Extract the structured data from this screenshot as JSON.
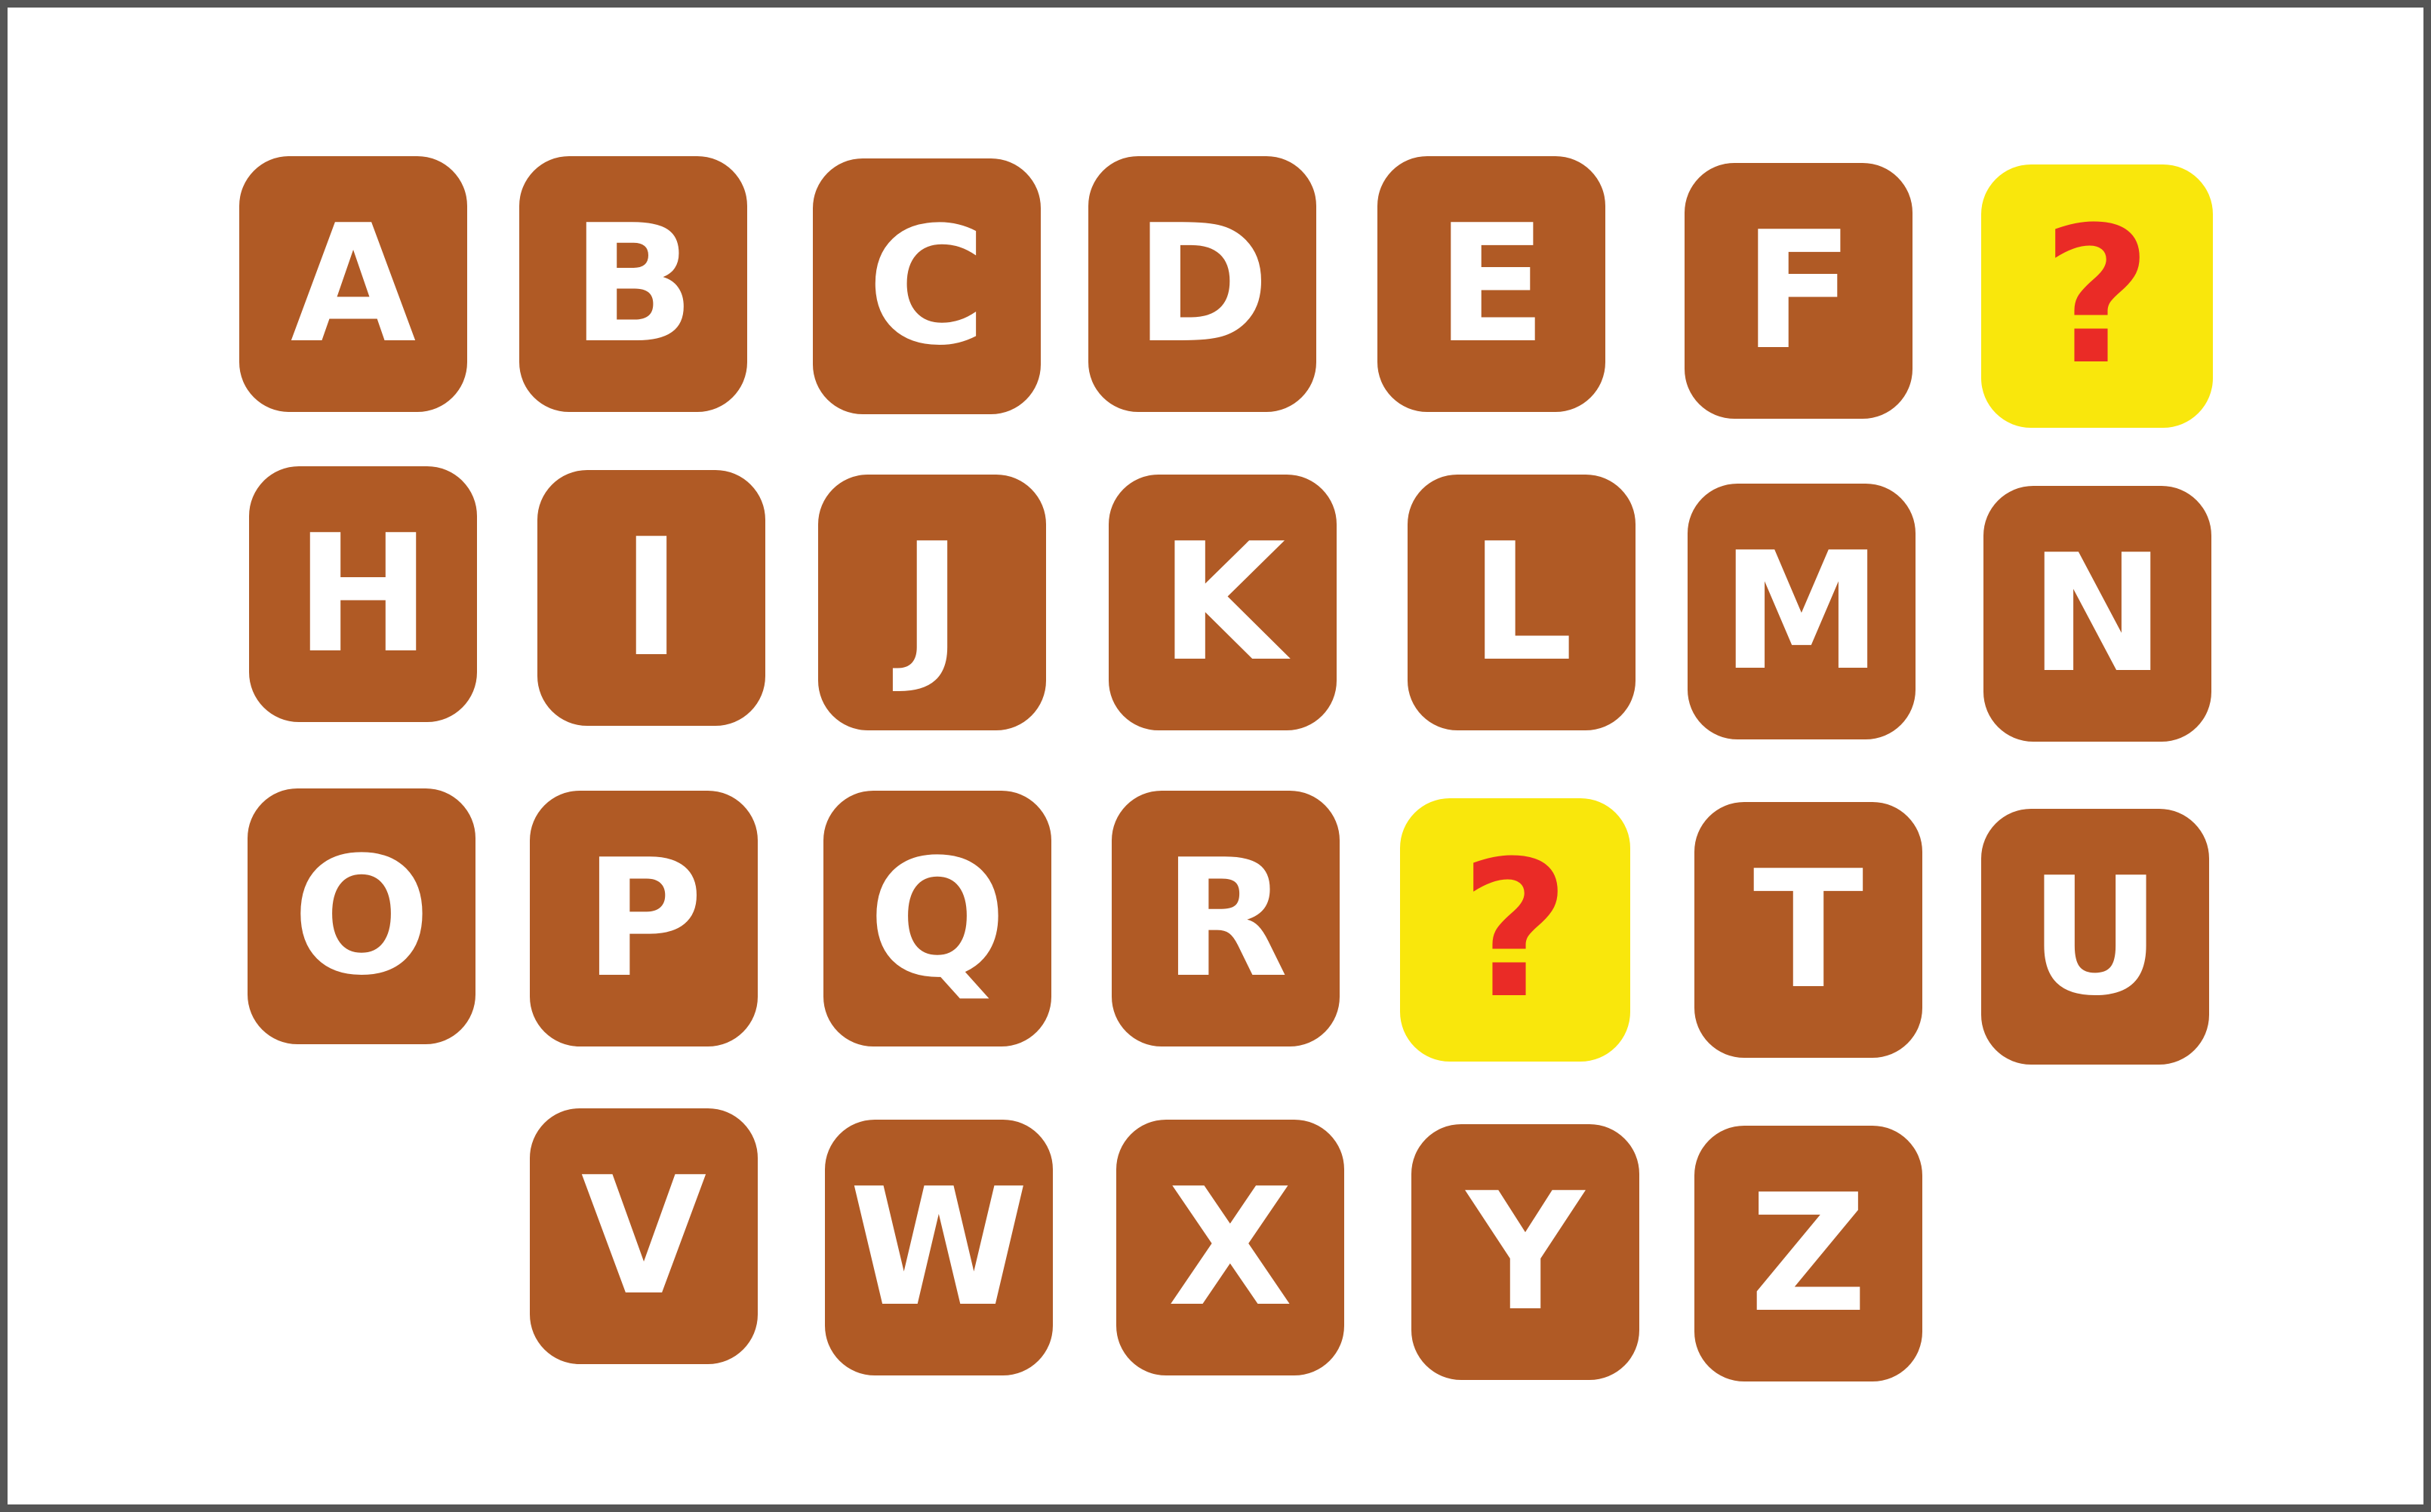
{
  "colors": {
    "tile": "#b05a25",
    "letter": "#ffffff",
    "missing_tile": "#f9e70c",
    "missing_mark": "#ea2b26",
    "frame": "#555555",
    "background": "#ffffff"
  },
  "tiles": [
    {
      "label": "A",
      "missing": false
    },
    {
      "label": "B",
      "missing": false
    },
    {
      "label": "C",
      "missing": false
    },
    {
      "label": "D",
      "missing": false
    },
    {
      "label": "E",
      "missing": false
    },
    {
      "label": "F",
      "missing": false
    },
    {
      "label": "?",
      "missing": true
    },
    {
      "label": "H",
      "missing": false
    },
    {
      "label": "I",
      "missing": false
    },
    {
      "label": "J",
      "missing": false
    },
    {
      "label": "K",
      "missing": false
    },
    {
      "label": "L",
      "missing": false
    },
    {
      "label": "M",
      "missing": false
    },
    {
      "label": "N",
      "missing": false
    },
    {
      "label": "O",
      "missing": false
    },
    {
      "label": "P",
      "missing": false
    },
    {
      "label": "Q",
      "missing": false
    },
    {
      "label": "R",
      "missing": false
    },
    {
      "label": "?",
      "missing": true
    },
    {
      "label": "T",
      "missing": false
    },
    {
      "label": "U",
      "missing": false
    },
    {
      "label": "V",
      "missing": false
    },
    {
      "label": "W",
      "missing": false
    },
    {
      "label": "X",
      "missing": false
    },
    {
      "label": "Y",
      "missing": false
    },
    {
      "label": "Z",
      "missing": false
    }
  ]
}
